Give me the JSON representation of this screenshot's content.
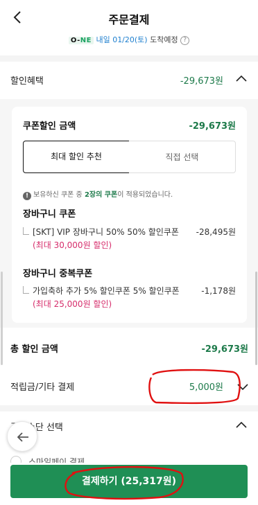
{
  "header": {
    "title": "주문결제"
  },
  "delivery": {
    "logo_prefix": "O-",
    "logo_suffix": "NE",
    "date_text": "내일 01/20(토)",
    "status_text": "도착예정",
    "help_glyph": "?"
  },
  "benefit": {
    "label": "할인혜택",
    "amount": "-29,673원"
  },
  "coupon": {
    "title": "쿠폰할인 금액",
    "amount": "-29,673원",
    "tabs": {
      "best": "최대 할인 추천",
      "direct": "직접 선택"
    },
    "info": {
      "icon": "!",
      "before": "보유하신 쿠폰 중 ",
      "count": "2장의 쿠폰",
      "after": "이 적용되었습니다."
    },
    "groups": [
      {
        "title": "장바구니 쿠폰",
        "item_text": "[SKT] VIP 장바구니 50% 50% 할인쿠폰 ",
        "item_limit": "(최대 30,000원 할인)",
        "price": "-28,495원"
      },
      {
        "title": "장바구니 중복쿠폰",
        "item_text": "가입축하 추가 5% 할인쿠폰 5% 할인쿠폰 ",
        "item_limit": "(최대 25,000원 할인)",
        "price": "-1,178원"
      }
    ]
  },
  "total": {
    "label": "총 할인 금액",
    "amount": "-29,673원"
  },
  "points": {
    "label": "적립금/기타 결제",
    "value": "5,000원"
  },
  "payment": {
    "label": "결제수단 선택",
    "partial_option": "스마일페이 결제"
  },
  "cta": {
    "label": "결제하기 (25,317원)"
  },
  "colors": {
    "brand_green": "#1f8f55",
    "amount_green": "#1d7a4a",
    "pink": "#d62d6b",
    "annotation_red": "#e01010"
  },
  "icons": [
    "back-icon",
    "help-icon",
    "chevron-up-icon",
    "chevron-down-icon",
    "info-icon",
    "arrow-left-icon"
  ]
}
